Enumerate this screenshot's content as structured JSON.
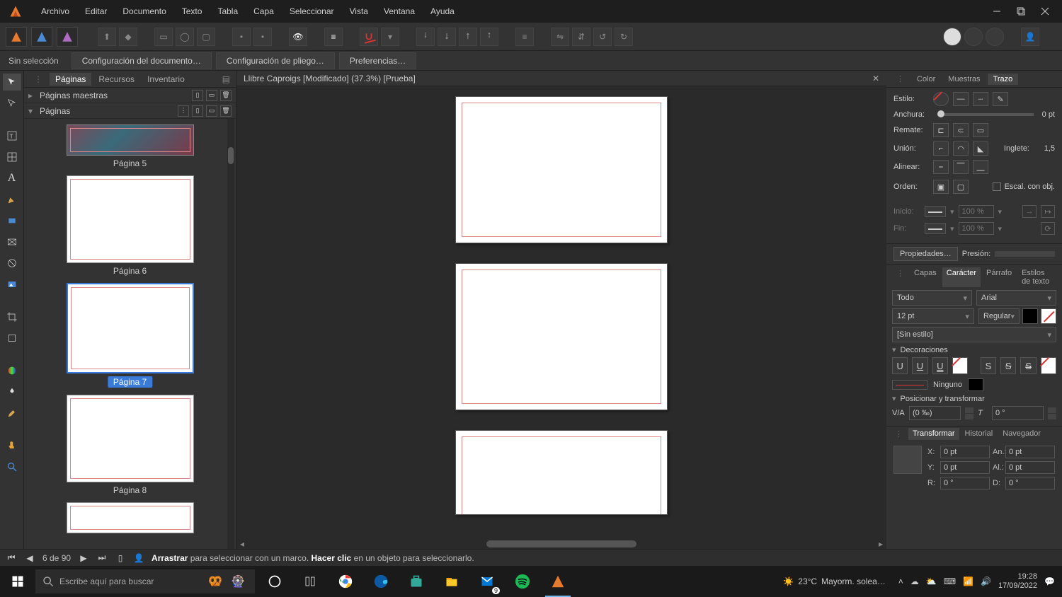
{
  "menu": {
    "archivo": "Archivo",
    "editar": "Editar",
    "documento": "Documento",
    "texto": "Texto",
    "tabla": "Tabla",
    "capa": "Capa",
    "seleccionar": "Seleccionar",
    "vista": "Vista",
    "ventana": "Ventana",
    "ayuda": "Ayuda"
  },
  "context": {
    "noSelection": "Sin selección",
    "docSetup": "Configuración del documento…",
    "spreadSetup": "Configuración de pliego…",
    "prefs": "Preferencias…"
  },
  "pagesPanel": {
    "tabs": {
      "paginas": "Páginas",
      "recursos": "Recursos",
      "inventario": "Inventario"
    },
    "masters": "Páginas maestras",
    "pagesHdr": "Páginas",
    "p5": "Página 5",
    "p6": "Página 6",
    "p7": "Página 7",
    "p8": "Página 8"
  },
  "docTab": "Llibre Caproigs [Modificado] (37.3%) [Prueba]",
  "rightTabs": {
    "color": "Color",
    "muestras": "Muestras",
    "trazo": "Trazo"
  },
  "stroke": {
    "estilo": "Estilo:",
    "anchura": "Anchura:",
    "anchuraVal": "0 pt",
    "remate": "Remate:",
    "union": "Unión:",
    "inglete": "Inglete:",
    "ingleteVal": "1,5",
    "alinear": "Alinear:",
    "orden": "Orden:",
    "escal": "Escal. con obj.",
    "inicio": "Inicio:",
    "fin": "Fin:",
    "pct": "100 %",
    "propiedades": "Propiedades…",
    "presion": "Presión:"
  },
  "charTabs": {
    "capas": "Capas",
    "caracter": "Carácter",
    "parrafo": "Párrafo",
    "estilos": "Estilos de texto"
  },
  "character": {
    "scope": "Todo",
    "font": "Arial",
    "size": "12 pt",
    "weight": "Regular",
    "style": "[Sin estilo]",
    "decor": "Decoraciones",
    "ninguno": "Ninguno",
    "postrans": "Posicionar y transformar",
    "kern": "(0 ‰)",
    "rot": "0 °"
  },
  "transTabs": {
    "transformar": "Transformar",
    "historial": "Historial",
    "navegador": "Navegador"
  },
  "transform": {
    "x": "X:",
    "y": "Y:",
    "an": "An.:",
    "al": "Al.:",
    "r": "R:",
    "d": "D:",
    "zero": "0 pt",
    "zerod": "0 °"
  },
  "status": {
    "pageCount": "6 de 90",
    "hint1": "Arrastrar",
    "hint1b": " para seleccionar con un marco. ",
    "hint2": "Hacer clic",
    "hint2b": " en un objeto para seleccionarlo."
  },
  "taskbar": {
    "search": "Escribe aquí para buscar",
    "weatherTemp": "23°C",
    "weatherDesc": "Mayorm. solea…",
    "time": "19:28",
    "date": "17/09/2022",
    "mailBadge": "9"
  }
}
